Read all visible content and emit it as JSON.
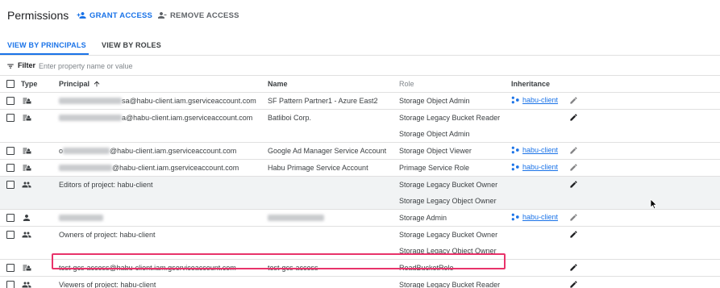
{
  "header": {
    "title": "Permissions",
    "grant_label": "GRANT ACCESS",
    "remove_label": "REMOVE ACCESS"
  },
  "tabs": {
    "principals": "VIEW BY PRINCIPALS",
    "roles": "VIEW BY ROLES",
    "active": "principals"
  },
  "filter": {
    "label": "Filter",
    "placeholder": "Enter property name or value"
  },
  "table": {
    "columns": {
      "type": "Type",
      "principal": "Principal",
      "name": "Name",
      "role": "Role",
      "inheritance": "Inheritance"
    },
    "sort": "principal-ascending",
    "rows": [
      {
        "type": "service-account",
        "principal": "sa@habu-client.iam.gserviceaccount.com",
        "principal_redacted": true,
        "name": "SF Pattern Partner1 - Azure East2",
        "roles": [
          "Storage Object Admin"
        ],
        "inheritance": "habu-client"
      },
      {
        "type": "service-account",
        "principal": "a@habu-client.iam.gserviceaccount.com",
        "principal_redacted": true,
        "name": "Batliboi Corp.",
        "roles": [
          "Storage Legacy Bucket Reader",
          "Storage Object Admin"
        ],
        "inheritance": ""
      },
      {
        "type": "service-account",
        "principal": "@habu-client.iam.gserviceaccount.com",
        "principal_redacted": true,
        "name": "Google Ad Manager Service Account",
        "roles": [
          "Storage Object Viewer"
        ],
        "inheritance": "habu-client"
      },
      {
        "type": "service-account",
        "principal": "@habu-client.iam.gserviceaccount.com",
        "principal_redacted": true,
        "name": "Habu Primage Service Account",
        "roles": [
          "Primage Service Role"
        ],
        "inheritance": "habu-client"
      },
      {
        "type": "group",
        "principal": "Editors of project: habu-client",
        "principal_redacted": false,
        "name": "",
        "roles": [
          "Storage Legacy Bucket Owner",
          "Storage Legacy Object Owner"
        ],
        "inheritance": ""
      },
      {
        "type": "user",
        "principal": "",
        "principal_redacted": true,
        "name": "",
        "name_redacted": true,
        "roles": [
          "Storage Admin"
        ],
        "inheritance": "habu-client"
      },
      {
        "type": "group",
        "principal": "Owners of project: habu-client",
        "principal_redacted": false,
        "name": "",
        "roles": [
          "Storage Legacy Bucket Owner",
          "Storage Legacy Object Owner"
        ],
        "inheritance": ""
      },
      {
        "type": "service-account",
        "principal": "test-gcs-access@habu-client.iam.gserviceaccount.com",
        "principal_redacted": false,
        "name": "test-gcs-access",
        "roles": [
          "ReadBucketRole"
        ],
        "inheritance": "",
        "highlighted": true
      },
      {
        "type": "group",
        "principal": "Viewers of project: habu-client",
        "principal_redacted": false,
        "name": "",
        "roles": [
          "Storage Legacy Bucket Reader"
        ],
        "inheritance": ""
      }
    ]
  },
  "colors": {
    "accent": "#1a73e8",
    "highlight": "#e8336a",
    "alt_row": "#f1f3f4"
  }
}
